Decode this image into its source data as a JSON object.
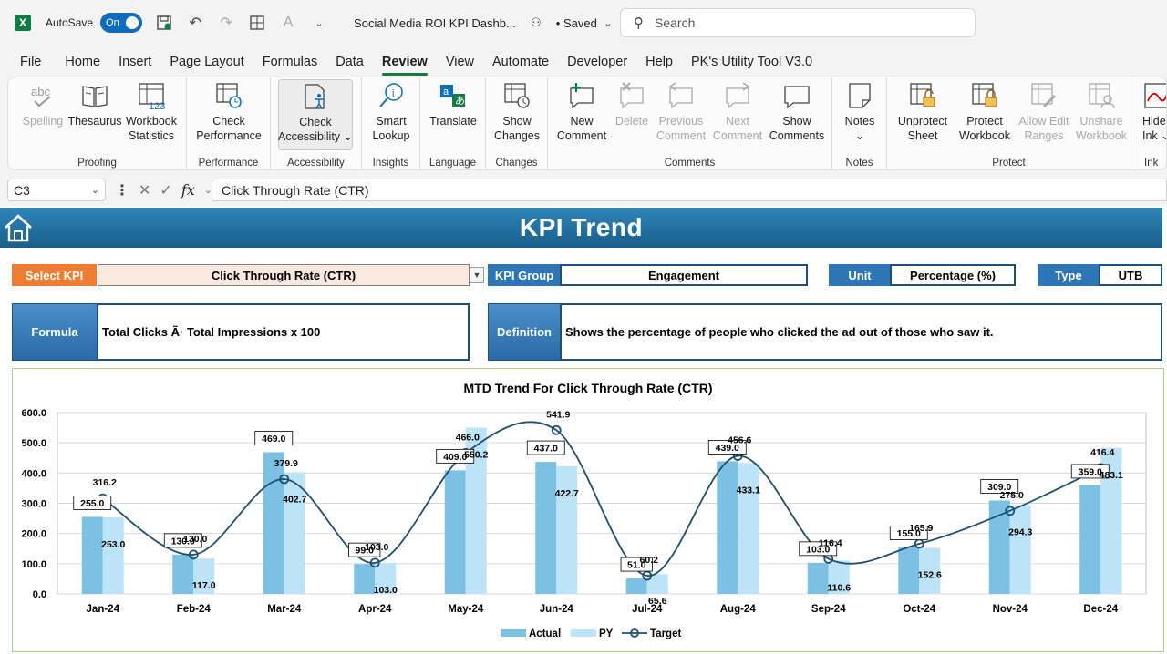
{
  "titlebar": {
    "app_icon": "X",
    "autosave_label": "AutoSave",
    "autosave_state": "On",
    "doc_title": "Social Media ROI KPI Dashb...",
    "saved_status": "• Saved",
    "search_placeholder": "Search"
  },
  "menu": {
    "tabs": [
      "File",
      "Home",
      "Insert",
      "Page Layout",
      "Formulas",
      "Data",
      "Review",
      "View",
      "Automate",
      "Developer",
      "Help",
      "PK's Utility Tool V3.0"
    ],
    "active": "Review"
  },
  "ribbon": {
    "groups": {
      "proofing": "Proofing",
      "performance": "Performance",
      "accessibility": "Accessibility",
      "insights": "Insights",
      "language": "Language",
      "changes": "Changes",
      "comments": "Comments",
      "notes": "Notes",
      "protect": "Protect",
      "ink": "Ink"
    },
    "buttons": {
      "spelling": "Spelling",
      "thesaurus": "Thesaurus",
      "workbook_statistics_1": "Workbook",
      "workbook_statistics_2": "Statistics",
      "check_performance_1": "Check",
      "check_performance_2": "Performance",
      "check_accessibility_1": "Check",
      "check_accessibility_2": "Accessibility ⌄",
      "smart_lookup_1": "Smart",
      "smart_lookup_2": "Lookup",
      "translate": "Translate",
      "show_changes_1": "Show",
      "show_changes_2": "Changes",
      "new_comment_1": "New",
      "new_comment_2": "Comment",
      "delete": "Delete",
      "previous_comment_1": "Previous",
      "previous_comment_2": "Comment",
      "next_comment_1": "Next",
      "next_comment_2": "Comment",
      "show_comments_1": "Show",
      "show_comments_2": "Comments",
      "notes": "Notes",
      "notes_caret": "⌄",
      "unprotect_sheet_1": "Unprotect",
      "unprotect_sheet_2": "Sheet",
      "protect_workbook_1": "Protect",
      "protect_workbook_2": "Workbook",
      "allow_edit_ranges_1": "Allow Edit",
      "allow_edit_ranges_2": "Ranges",
      "unshare_workbook_1": "Unshare",
      "unshare_workbook_2": "Workbook",
      "hide_ink_1": "Hide",
      "hide_ink_2": "Ink ⌄"
    }
  },
  "formula_bar": {
    "name_box": "C3",
    "fx": "fx",
    "formula": "Click Through Rate (CTR)"
  },
  "dashboard": {
    "title": "KPI Trend",
    "select_kpi_label": "Select KPI",
    "select_kpi_value": "Click Through Rate (CTR)",
    "kpi_group_label": "KPI Group",
    "kpi_group_value": "Engagement",
    "unit_label": "Unit",
    "unit_value": "Percentage (%)",
    "type_label": "Type",
    "type_value": "UTB",
    "formula_label": "Formula",
    "formula_value": "Total Clicks Ã· Total Impressions x 100",
    "definition_label": "Definition",
    "definition_value": "Shows the percentage of people who clicked the ad out of those who saw it."
  },
  "colors": {
    "actual": "#7cc1e4",
    "py": "#bde3f6",
    "target": "#1f4e6e",
    "banner": "#2277a8",
    "select_label": "#ed7d31"
  },
  "chart_data": {
    "type": "bar",
    "title": "MTD Trend For Click Through Rate (CTR)",
    "categories": [
      "Jan-24",
      "Feb-24",
      "Mar-24",
      "Apr-24",
      "May-24",
      "Jun-24",
      "Jul-24",
      "Aug-24",
      "Sep-24",
      "Oct-24",
      "Nov-24",
      "Dec-24"
    ],
    "series": [
      {
        "name": "Actual",
        "type": "bar",
        "values": [
          255.0,
          130.0,
          469.0,
          99.0,
          409.0,
          437.0,
          51.0,
          439.0,
          103.0,
          155.0,
          309.0,
          359.0
        ]
      },
      {
        "name": "PY",
        "type": "bar",
        "values": [
          253.0,
          117.0,
          402.7,
          103.0,
          550.2,
          422.7,
          65.6,
          433.1,
          110.6,
          152.6,
          294.3,
          483.1
        ]
      },
      {
        "name": "Target",
        "type": "line",
        "values": [
          316.2,
          130.0,
          379.9,
          103.0,
          466.0,
          541.9,
          60.2,
          456.6,
          116.4,
          165.9,
          275.0,
          416.4
        ]
      }
    ],
    "ylim": [
      0,
      600
    ],
    "yticks": [
      "0.0",
      "100.0",
      "200.0",
      "300.0",
      "400.0",
      "500.0",
      "600.0"
    ],
    "grid": true,
    "legend": "bottom"
  }
}
